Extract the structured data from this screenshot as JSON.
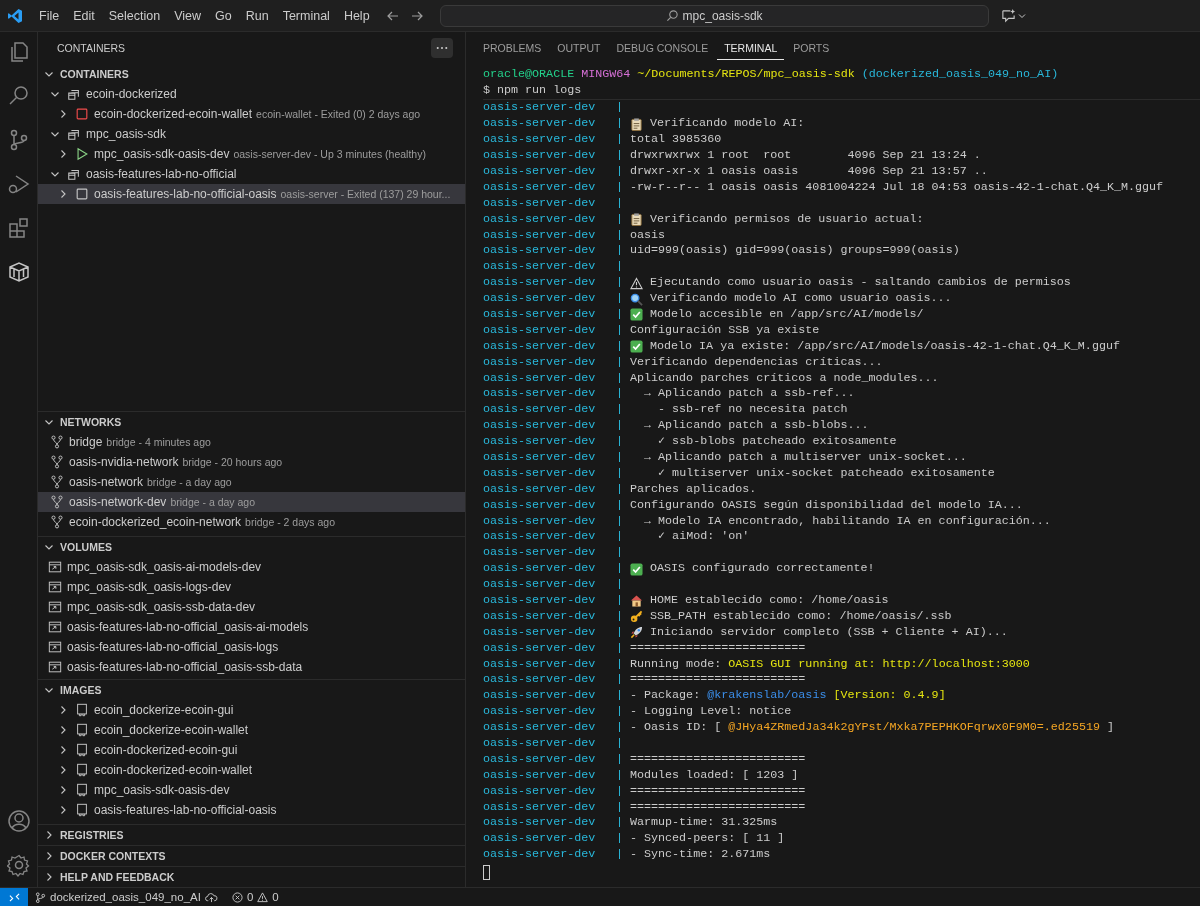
{
  "menu": [
    "File",
    "Edit",
    "Selection",
    "View",
    "Go",
    "Run",
    "Terminal",
    "Help"
  ],
  "command_center": {
    "text": "mpc_oasis-sdk"
  },
  "sidebar": {
    "title": "CONTAINERS",
    "containers": {
      "title": "CONTAINERS",
      "expanded": true,
      "groups": [
        {
          "name": "ecoin-dockerized",
          "expanded": true,
          "selected": false,
          "children": [
            {
              "name": "ecoin-dockerized-ecoin-wallet",
              "description": "ecoin-wallet - Exited (0) 2 days ago",
              "kind": "failed",
              "expanded": false,
              "selected": false
            }
          ]
        },
        {
          "name": "mpc_oasis-sdk",
          "expanded": true,
          "selected": false,
          "children": [
            {
              "name": "mpc_oasis-sdk-oasis-dev",
              "description": "oasis-server-dev - Up 3 minutes (healthy)",
              "kind": "running",
              "expanded": false,
              "selected": false
            }
          ]
        },
        {
          "name": "oasis-features-lab-no-official",
          "expanded": true,
          "selected": false,
          "children": [
            {
              "name": "oasis-features-lab-no-official-oasis",
              "description": "oasis-server - Exited (137) 29 hour...",
              "kind": "stopped",
              "expanded": false,
              "selected": true
            }
          ]
        }
      ]
    },
    "networks": {
      "title": "NETWORKS",
      "expanded": true,
      "items": [
        {
          "name": "bridge",
          "description": "bridge - 4 minutes ago",
          "selected": false
        },
        {
          "name": "oasis-nvidia-network",
          "description": "bridge - 20 hours ago",
          "selected": false
        },
        {
          "name": "oasis-network",
          "description": "bridge - a day ago",
          "selected": false
        },
        {
          "name": "oasis-network-dev",
          "description": "bridge - a day ago",
          "selected": true
        },
        {
          "name": "ecoin-dockerized_ecoin-network",
          "description": "bridge - 2 days ago",
          "selected": false
        }
      ]
    },
    "volumes": {
      "title": "VOLUMES",
      "expanded": true,
      "items": [
        {
          "name": "mpc_oasis-sdk_oasis-ai-models-dev",
          "selected": false
        },
        {
          "name": "mpc_oasis-sdk_oasis-logs-dev",
          "selected": false
        },
        {
          "name": "mpc_oasis-sdk_oasis-ssb-data-dev",
          "selected": false
        },
        {
          "name": "oasis-features-lab-no-official_oasis-ai-models",
          "selected": false
        },
        {
          "name": "oasis-features-lab-no-official_oasis-logs",
          "selected": false
        },
        {
          "name": "oasis-features-lab-no-official_oasis-ssb-data",
          "selected": false
        }
      ]
    },
    "images": {
      "title": "IMAGES",
      "expanded": true,
      "items": [
        {
          "name": "ecoin_dockerize-ecoin-gui",
          "expanded": false,
          "selected": false
        },
        {
          "name": "ecoin_dockerize-ecoin-wallet",
          "expanded": false,
          "selected": false
        },
        {
          "name": "ecoin-dockerized-ecoin-gui",
          "expanded": false,
          "selected": false
        },
        {
          "name": "ecoin-dockerized-ecoin-wallet",
          "expanded": false,
          "selected": false
        },
        {
          "name": "mpc_oasis-sdk-oasis-dev",
          "expanded": false,
          "selected": false
        },
        {
          "name": "oasis-features-lab-no-official-oasis",
          "expanded": false,
          "selected": false
        }
      ]
    },
    "collapsed_sections": [
      {
        "title": "REGISTRIES",
        "expanded": false
      },
      {
        "title": "DOCKER CONTEXTS",
        "expanded": false
      },
      {
        "title": "HELP AND FEEDBACK",
        "expanded": false
      }
    ]
  },
  "panel": {
    "tabs": [
      {
        "label": "PROBLEMS",
        "selected": false
      },
      {
        "label": "OUTPUT",
        "selected": false
      },
      {
        "label": "DEBUG CONSOLE",
        "selected": false
      },
      {
        "label": "TERMINAL",
        "selected": true
      },
      {
        "label": "PORTS",
        "selected": false
      }
    ],
    "prompt": [
      {
        "text": "oracle@ORACLE",
        "color": "#23d18b"
      },
      {
        "text": "MINGW64",
        "color": "#d670d6"
      },
      {
        "text": "~/Documents/REPOS/mpc_oasis-sdk",
        "color": "#e5e510"
      },
      {
        "text": "(dockerized_oasis_049_no_AI)",
        "color": "#29b8db"
      }
    ],
    "command": "$ npm run logs",
    "lines": [
      {
        "source": "oasis-server-dev",
        "separator": "|",
        "kind": "plain"
      },
      {
        "source": "oasis-server-dev",
        "separator": "|",
        "kind": "clipboard",
        "segments": [
          {
            "text": "Verificando modelo AI:"
          }
        ]
      },
      {
        "source": "oasis-server-dev",
        "separator": "|",
        "kind": "plain",
        "segments": [
          {
            "text": "total 3985360"
          }
        ]
      },
      {
        "source": "oasis-server-dev",
        "separator": "|",
        "kind": "plain",
        "segments": [
          {
            "text": "drwxrwxrwx 1 root  root        4096 Sep 21 13:24 ."
          }
        ]
      },
      {
        "source": "oasis-server-dev",
        "separator": "|",
        "kind": "plain",
        "segments": [
          {
            "text": "drwxr-xr-x 1 oasis oasis       4096 Sep 21 13:57 .."
          }
        ]
      },
      {
        "source": "oasis-server-dev",
        "separator": "|",
        "kind": "plain",
        "segments": [
          {
            "text": "-rw-r--r-- 1 oasis oasis 4081004224 Jul 18 04:53 oasis-42-1-chat.Q4_K_M.gguf"
          }
        ]
      },
      {
        "source": "oasis-server-dev",
        "separator": "|",
        "kind": "plain"
      },
      {
        "source": "oasis-server-dev",
        "separator": "|",
        "kind": "clipboard",
        "segments": [
          {
            "text": "Verificando permisos de usuario actual:"
          }
        ]
      },
      {
        "source": "oasis-server-dev",
        "separator": "|",
        "kind": "plain",
        "segments": [
          {
            "text": "oasis"
          }
        ]
      },
      {
        "source": "oasis-server-dev",
        "separator": "|",
        "kind": "plain",
        "segments": [
          {
            "text": "uid=999(oasis) gid=999(oasis) groups=999(oasis)"
          }
        ]
      },
      {
        "source": "oasis-server-dev",
        "separator": "|",
        "kind": "plain"
      },
      {
        "source": "oasis-server-dev",
        "separator": "|",
        "kind": "warning",
        "segments": [
          {
            "text": "Ejecutando como usuario oasis - saltando cambios de permisos"
          }
        ]
      },
      {
        "source": "oasis-server-dev",
        "separator": "|",
        "kind": "search",
        "segments": [
          {
            "text": "Verificando modelo AI como usuario oasis..."
          }
        ]
      },
      {
        "source": "oasis-server-dev",
        "separator": "|",
        "kind": "success",
        "segments": [
          {
            "text": "Modelo accesible en /app/src/AI/models/"
          }
        ]
      },
      {
        "source": "oasis-server-dev",
        "separator": "|",
        "kind": "plain",
        "segments": [
          {
            "text": "Configuración SSB ya existe"
          }
        ]
      },
      {
        "source": "oasis-server-dev",
        "separator": "|",
        "kind": "success",
        "segments": [
          {
            "text": "Modelo IA ya existe: /app/src/AI/models/oasis-42-1-chat.Q4_K_M.gguf"
          }
        ]
      },
      {
        "source": "oasis-server-dev",
        "separator": "|",
        "kind": "plain",
        "segments": [
          {
            "text": "Verificando dependencias críticas..."
          }
        ]
      },
      {
        "source": "oasis-server-dev",
        "separator": "|",
        "kind": "plain",
        "segments": [
          {
            "text": "Aplicando parches críticos a node_modules..."
          }
        ]
      },
      {
        "source": "oasis-server-dev",
        "separator": "|",
        "kind": "plain",
        "segments": [
          {
            "text": "  → Aplicando patch a ssb-ref..."
          }
        ]
      },
      {
        "source": "oasis-server-dev",
        "separator": "|",
        "kind": "plain",
        "segments": [
          {
            "text": "    - ssb-ref no necesita patch"
          }
        ]
      },
      {
        "source": "oasis-server-dev",
        "separator": "|",
        "kind": "plain",
        "segments": [
          {
            "text": "  → Aplicando patch a ssb-blobs..."
          }
        ]
      },
      {
        "source": "oasis-server-dev",
        "separator": "|",
        "kind": "plain",
        "segments": [
          {
            "text": "    ✓ ssb-blobs patcheado exitosamente"
          }
        ]
      },
      {
        "source": "oasis-server-dev",
        "separator": "|",
        "kind": "plain",
        "segments": [
          {
            "text": "  → Aplicando patch a multiserver unix-socket..."
          }
        ]
      },
      {
        "source": "oasis-server-dev",
        "separator": "|",
        "kind": "plain",
        "segments": [
          {
            "text": "    ✓ multiserver unix-socket patcheado exitosamente"
          }
        ]
      },
      {
        "source": "oasis-server-dev",
        "separator": "|",
        "kind": "plain",
        "segments": [
          {
            "text": "Parches aplicados."
          }
        ]
      },
      {
        "source": "oasis-server-dev",
        "separator": "|",
        "kind": "plain",
        "segments": [
          {
            "text": "Configurando OASIS según disponibilidad del modelo IA..."
          }
        ]
      },
      {
        "source": "oasis-server-dev",
        "separator": "|",
        "kind": "plain",
        "segments": [
          {
            "text": "  → Modelo IA encontrado, habilitando IA en configuración..."
          }
        ]
      },
      {
        "source": "oasis-server-dev",
        "separator": "|",
        "kind": "plain",
        "segments": [
          {
            "text": "    ✓ aiMod: 'on'"
          }
        ]
      },
      {
        "source": "oasis-server-dev",
        "separator": "|",
        "kind": "plain"
      },
      {
        "source": "oasis-server-dev",
        "separator": "|",
        "kind": "success",
        "segments": [
          {
            "text": "OASIS configurado correctamente!"
          }
        ]
      },
      {
        "source": "oasis-server-dev",
        "separator": "|",
        "kind": "plain"
      },
      {
        "source": "oasis-server-dev",
        "separator": "|",
        "kind": "home",
        "segments": [
          {
            "text": "HOME establecido como: /home/oasis"
          }
        ]
      },
      {
        "source": "oasis-server-dev",
        "separator": "|",
        "kind": "key",
        "segments": [
          {
            "text": "SSB_PATH establecido como: /home/oasis/.ssb"
          }
        ]
      },
      {
        "source": "oasis-server-dev",
        "separator": "|",
        "kind": "rocket",
        "segments": [
          {
            "text": "Iniciando servidor completo (SSB + Cliente + AI)..."
          }
        ]
      },
      {
        "source": "oasis-server-dev",
        "separator": "|",
        "kind": "plain",
        "segments": [
          {
            "text": "========================="
          }
        ]
      },
      {
        "source": "oasis-server-dev",
        "separator": "|",
        "kind": "plain",
        "segments": [
          {
            "text": "Running mode:"
          },
          {
            "text": "OASIS GUI running at: http://localhost:3000",
            "color": "#e5e510"
          }
        ]
      },
      {
        "source": "oasis-server-dev",
        "separator": "|",
        "kind": "plain",
        "segments": [
          {
            "text": "========================="
          }
        ]
      },
      {
        "source": "oasis-server-dev",
        "separator": "|",
        "kind": "plain",
        "segments": [
          {
            "text": "- Package:"
          },
          {
            "text": "@krakenslab/oasis",
            "color": "#3b8eea"
          },
          {
            "text": "[Version: 0.4.9]",
            "color": "#e5e510"
          }
        ]
      },
      {
        "source": "oasis-server-dev",
        "separator": "|",
        "kind": "plain",
        "segments": [
          {
            "text": "- Logging Level: notice"
          }
        ]
      },
      {
        "source": "oasis-server-dev",
        "separator": "|",
        "kind": "plain",
        "segments": [
          {
            "text": "- Oasis ID: ["
          },
          {
            "text": "@JHya4ZRmedJa34k2gYPst/Mxka7PEPHKOFqrwx0F9M0=.ed25519",
            "color": "#f5a623"
          },
          {
            "text": "]"
          }
        ]
      },
      {
        "source": "oasis-server-dev",
        "separator": "|",
        "kind": "plain"
      },
      {
        "source": "oasis-server-dev",
        "separator": "|",
        "kind": "plain",
        "segments": [
          {
            "text": "========================="
          }
        ]
      },
      {
        "source": "oasis-server-dev",
        "separator": "|",
        "kind": "plain",
        "segments": [
          {
            "text": "Modules loaded: [ 1203 ]"
          }
        ]
      },
      {
        "source": "oasis-server-dev",
        "separator": "|",
        "kind": "plain",
        "segments": [
          {
            "text": "========================="
          }
        ]
      },
      {
        "source": "oasis-server-dev",
        "separator": "|",
        "kind": "plain",
        "segments": [
          {
            "text": "========================="
          }
        ]
      },
      {
        "source": "oasis-server-dev",
        "separator": "|",
        "kind": "plain",
        "segments": [
          {
            "text": "Warmup-time: 31.325ms"
          }
        ]
      },
      {
        "source": "oasis-server-dev",
        "separator": "|",
        "kind": "plain",
        "segments": [
          {
            "text": "- Synced-peers: [ 11 ]"
          }
        ]
      },
      {
        "source": "oasis-server-dev",
        "separator": "|",
        "kind": "plain",
        "segments": [
          {
            "text": "- Sync-time: 2.671ms"
          }
        ]
      }
    ]
  },
  "status_bar": {
    "branch": "dockerized_oasis_049_no_AI",
    "errors": "0",
    "warnings": "0"
  }
}
